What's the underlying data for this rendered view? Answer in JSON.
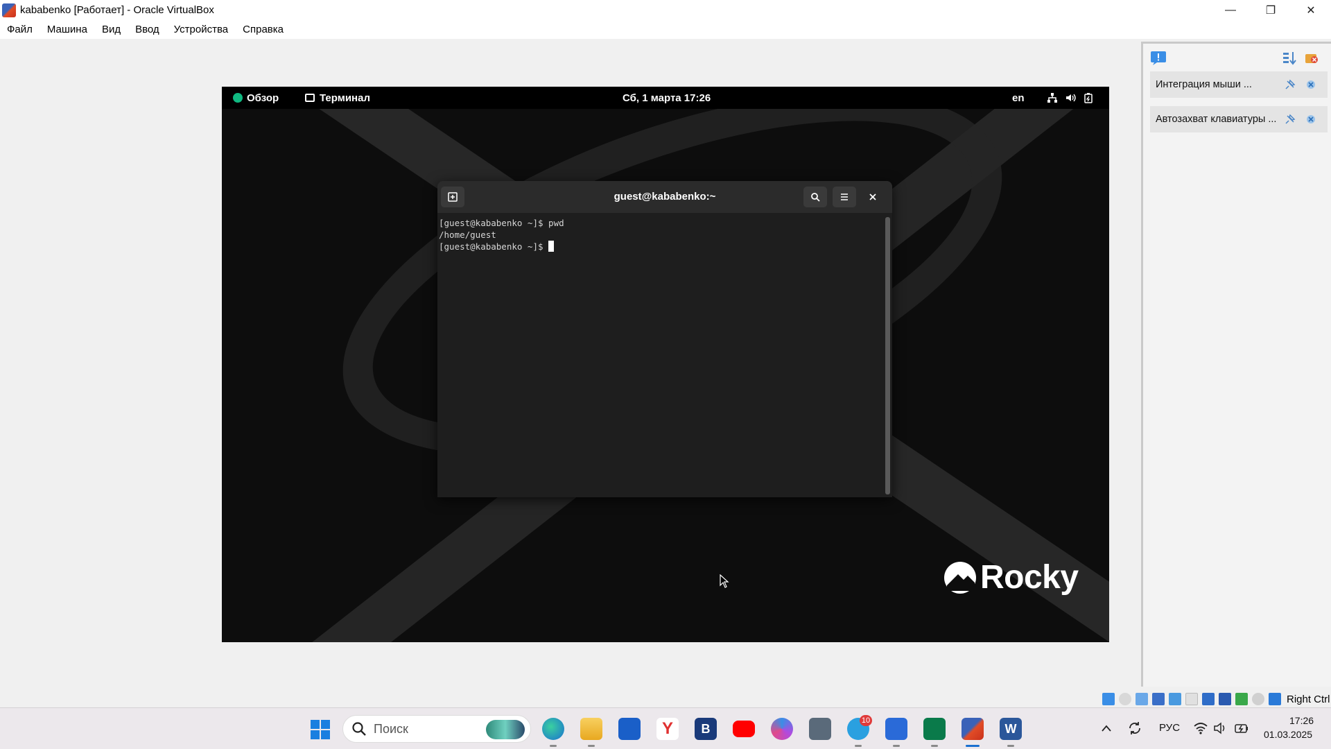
{
  "window": {
    "title": "kababenko [Работает] - Oracle VirtualBox",
    "minimize_icon": "—",
    "restore_icon": "❐",
    "close_icon": "✕"
  },
  "menu": [
    "Файл",
    "Машина",
    "Вид",
    "Ввод",
    "Устройства",
    "Справка"
  ],
  "gnome_bar": {
    "activities": "Обзор",
    "app": "Терминал",
    "clock": "Сб, 1 марта  17:26",
    "keyboard_layout": "en"
  },
  "terminal": {
    "title": "guest@kababenko:~",
    "lines": [
      "[guest@kababenko ~]$ pwd",
      "/home/guest",
      "[guest@kababenko ~]$ "
    ]
  },
  "desktop": {
    "logo_text": "Rocky"
  },
  "notifications": [
    {
      "text": "Интеграция мыши ..."
    },
    {
      "text": "Автозахват клавиатуры ..."
    }
  ],
  "vb_status": {
    "host_key": "Right Ctrl"
  },
  "taskbar": {
    "search_placeholder": "Поиск",
    "telegram_badge": "10",
    "language": "РУС",
    "time": "17:26",
    "date": "01.03.2025"
  },
  "colors": {
    "rocky_green": "#10b981",
    "terminal_bg": "#1e1e1e",
    "terminal_header": "#2b2b2b",
    "taskbar_bg": "#ece8ec"
  }
}
